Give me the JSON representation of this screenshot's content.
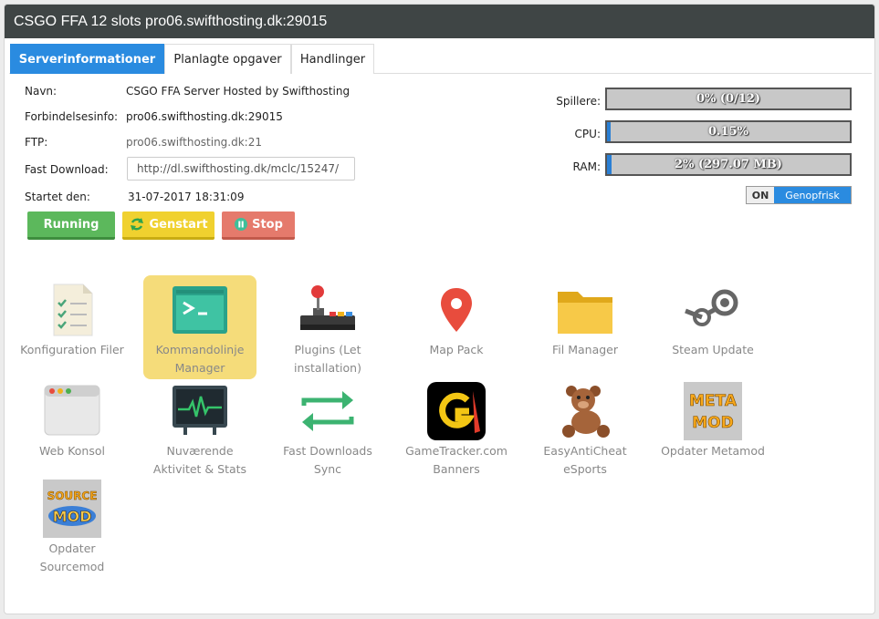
{
  "window": {
    "title": "CSGO FFA 12 slots pro06.swifthosting.dk:29015"
  },
  "tabs": [
    {
      "label": "Serverinformationer",
      "active": true
    },
    {
      "label": "Planlagte opgaver",
      "active": false
    },
    {
      "label": "Handlinger",
      "active": false
    }
  ],
  "info": {
    "name_label": "Navn:",
    "name_value": "CSGO FFA Server Hosted by Swifthosting",
    "conn_label": "Forbindelsesinfo:",
    "conn_value": "pro06.swifthosting.dk:29015",
    "ftp_label": "FTP:",
    "ftp_value": "pro06.swifthosting.dk:21",
    "fastdl_label": "Fast Download:",
    "fastdl_value": "http://dl.swifthosting.dk/mclc/15247/",
    "started_label": "Startet den:",
    "started_value": "31-07-2017 18:31:09"
  },
  "buttons": {
    "running": "Running",
    "restart": "Genstart",
    "stop": "Stop"
  },
  "meters": {
    "players_label": "Spillere:",
    "players_text": "0% (0/12)",
    "players_fraction": 0.0,
    "cpu_label": "CPU:",
    "cpu_text": "0.15%",
    "cpu_fraction": 0.0015,
    "ram_label": "RAM:",
    "ram_text": "2% (297.07 MB)",
    "ram_fraction": 0.02
  },
  "toggle": {
    "state": "ON",
    "label": "Genopfrisk"
  },
  "tools": [
    {
      "label": "Konfiguration Filer",
      "icon": "config-files-icon"
    },
    {
      "label": "Kommandolinje Manager",
      "icon": "terminal-icon",
      "active": true
    },
    {
      "label": "Plugins (Let installation)",
      "icon": "joystick-icon"
    },
    {
      "label": "Map Pack",
      "icon": "map-pin-icon"
    },
    {
      "label": "Fil Manager",
      "icon": "folder-icon"
    },
    {
      "label": "Steam Update",
      "icon": "steam-icon"
    },
    {
      "label": "Web Konsol",
      "icon": "browser-window-icon"
    },
    {
      "label": "Nuværende Aktivitet & Stats",
      "icon": "monitor-pulse-icon"
    },
    {
      "label": "Fast Downloads Sync",
      "icon": "sync-arrows-icon"
    },
    {
      "label": "GameTracker.com Banners",
      "icon": "gametracker-logo-icon"
    },
    {
      "label": "EasyAntiCheat eSports",
      "icon": "teddy-bear-icon"
    },
    {
      "label": "Opdater Metamod",
      "icon": "metamod-logo-icon"
    },
    {
      "label": "Opdater Sourcemod",
      "icon": "sourcemod-logo-icon"
    }
  ],
  "logo_text": {
    "meta": "META",
    "mod": "MOD",
    "source": "SOURCE"
  }
}
